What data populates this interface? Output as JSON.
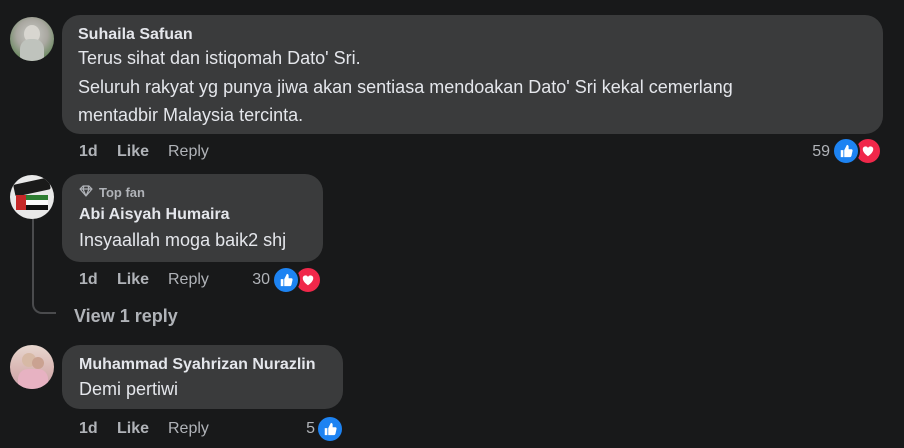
{
  "comments": [
    {
      "author": "Suhaila Safuan",
      "lines": [
        "Terus sihat dan istiqomah Dato' Sri.",
        "Seluruh rakyat yg punya jiwa akan sentiasa mendoakan Dato' Sri kekal cemerlang",
        "mentadbir Malaysia tercinta."
      ],
      "time": "1d",
      "like_label": "Like",
      "reply_label": "Reply",
      "reaction_count": "59",
      "reactions": [
        "like-icon",
        "love-icon"
      ]
    },
    {
      "badge": "Top fan",
      "badge_icon": "diamond-icon",
      "author": "Abi Aisyah Humaira",
      "lines": [
        "Insyaallah moga baik2 shj"
      ],
      "time": "1d",
      "like_label": "Like",
      "reply_label": "Reply",
      "reaction_count": "30",
      "reactions": [
        "like-icon",
        "love-icon"
      ],
      "view_replies": "View 1 reply"
    },
    {
      "author": "Muhammad Syahrizan Nurazlin",
      "lines": [
        "Demi pertiwi"
      ],
      "time": "1d",
      "like_label": "Like",
      "reply_label": "Reply",
      "reaction_count": "5",
      "reactions": [
        "like-icon"
      ]
    }
  ],
  "colors": {
    "background": "#18191a",
    "bubble": "#3a3b3c",
    "text": "#e4e6eb",
    "secondary": "#b0b3b8",
    "like_blue": "#1d83f2",
    "love_red": "#f0284a"
  }
}
